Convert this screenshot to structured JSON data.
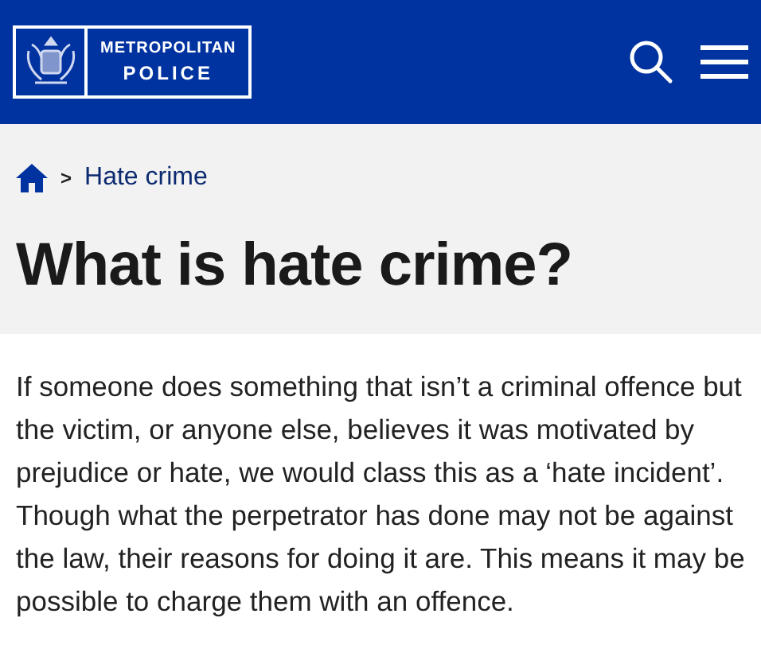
{
  "header": {
    "logo_line_1": "METROPOLITAN",
    "logo_line_2": "POLICE"
  },
  "breadcrumb": {
    "items": [
      "Hate crime"
    ],
    "separator": ">"
  },
  "title": "What is hate crime?",
  "body": "If someone does something that isn’t a criminal offence but the victim, or anyone else, believes it was motivated by prejudice or hate, we would class this as a ‘hate incident’. Though what the perpetrator has done may not be against the law, their reasons for doing it are. This means it may be possible to charge them with an offence."
}
